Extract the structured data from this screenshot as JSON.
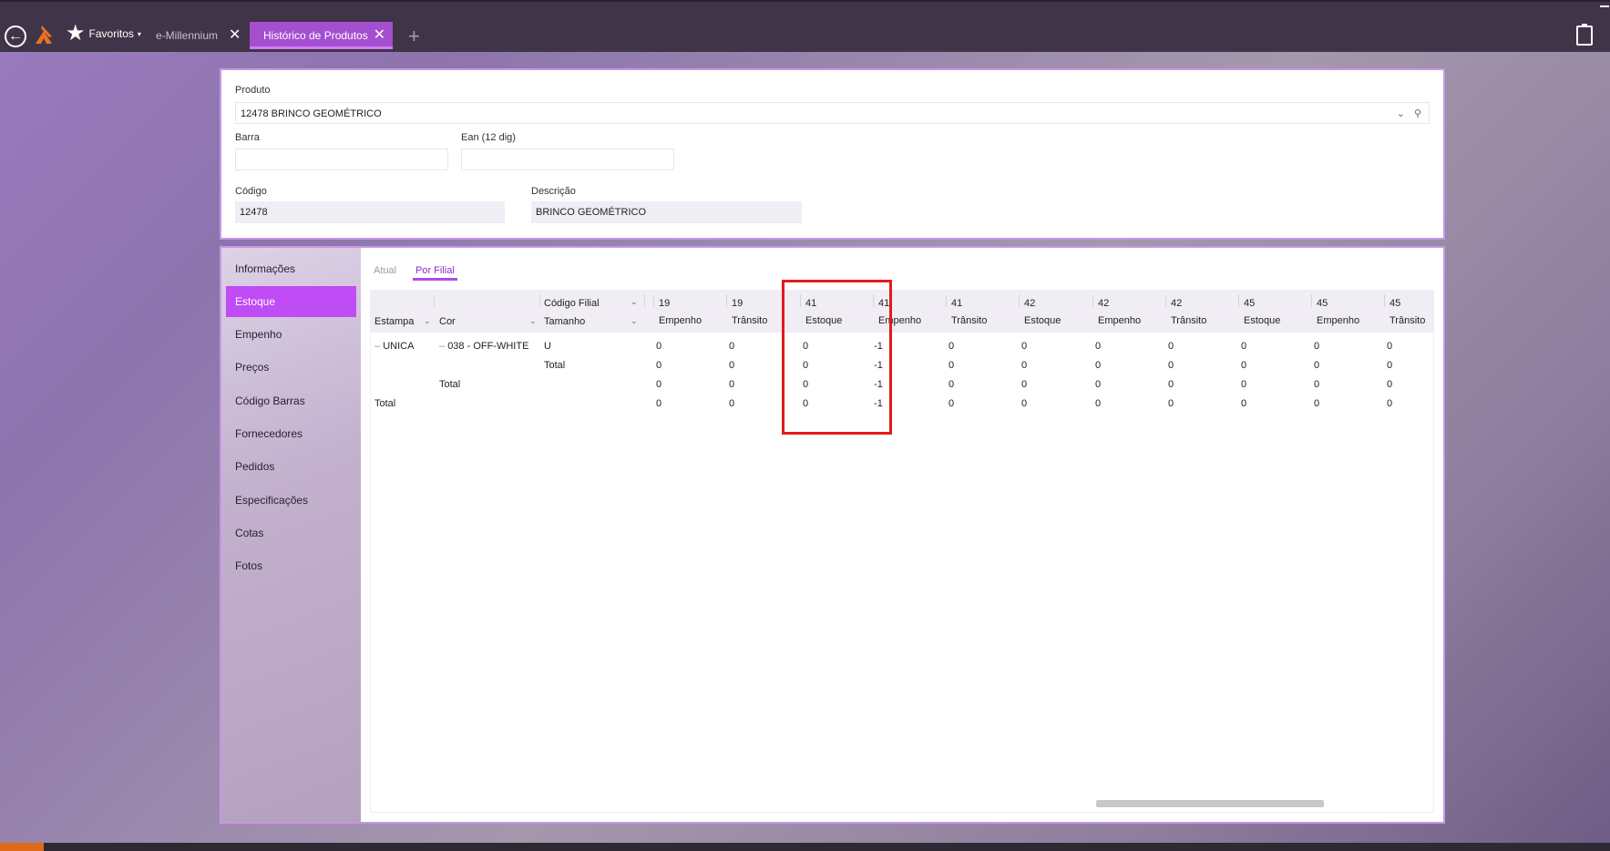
{
  "topbar": {
    "favorites_label": "Favoritos",
    "tabs": [
      {
        "label": "e-Millennium",
        "close": "✕"
      },
      {
        "label": "Histórico de Produtos",
        "close": "✕"
      }
    ],
    "add_tab": "+"
  },
  "product_form": {
    "produto_label": "Produto",
    "produto_value": "12478 BRINCO GEOMÉTRICO",
    "barra_label": "Barra",
    "barra_value": "",
    "ean_label": "Ean (12 dig)",
    "ean_value": "",
    "codigo_label": "Código",
    "codigo_value": "12478",
    "descricao_label": "Descrição",
    "descricao_value": "BRINCO GEOMÉTRICO"
  },
  "sidebar": {
    "items": [
      {
        "label": "Informações"
      },
      {
        "label": "Estoque",
        "active": true
      },
      {
        "label": "Empenho"
      },
      {
        "label": "Preços"
      },
      {
        "label": "Código Barras"
      },
      {
        "label": "Fornecedores"
      },
      {
        "label": "Pedidos"
      },
      {
        "label": "Especificações"
      },
      {
        "label": "Cotas"
      },
      {
        "label": "Fotos"
      }
    ]
  },
  "subtabs": {
    "atual": "Atual",
    "por_filial": "Por Filial"
  },
  "grid": {
    "col_estampa": "Estampa",
    "col_cor": "Cor",
    "col_tamanho": "Tamanho",
    "col_codigo_filial": "Código Filial",
    "filial_codes": [
      "19",
      "19",
      "41",
      "41",
      "41",
      "42",
      "42",
      "42",
      "45",
      "45",
      "45"
    ],
    "measures": [
      "Empenho",
      "Trânsito",
      "Estoque",
      "Empenho",
      "Trânsito",
      "Estoque",
      "Empenho",
      "Trânsito",
      "Estoque",
      "Empenho",
      "Trânsito"
    ],
    "rows": [
      {
        "estampa": "UNICA",
        "cor": "038 - OFF-WHITE",
        "tamanho": "U",
        "values": [
          "0",
          "0",
          "0",
          "-1",
          "0",
          "0",
          "0",
          "0",
          "0",
          "0",
          "0"
        ]
      },
      {
        "estampa": "",
        "cor": "",
        "tamanho": "Total",
        "values": [
          "0",
          "0",
          "0",
          "-1",
          "0",
          "0",
          "0",
          "0",
          "0",
          "0",
          "0"
        ]
      },
      {
        "estampa": "",
        "cor": "Total",
        "tamanho": "",
        "values": [
          "0",
          "0",
          "0",
          "-1",
          "0",
          "0",
          "0",
          "0",
          "0",
          "0",
          "0"
        ]
      },
      {
        "estampa": "Total",
        "cor": "",
        "tamanho": "",
        "values": [
          "0",
          "0",
          "0",
          "-1",
          "0",
          "0",
          "0",
          "0",
          "0",
          "0",
          "0"
        ]
      }
    ]
  },
  "colors": {
    "accent": "#c04cf5",
    "topbar": "#3f3448",
    "highlight": "#e31b1b"
  }
}
